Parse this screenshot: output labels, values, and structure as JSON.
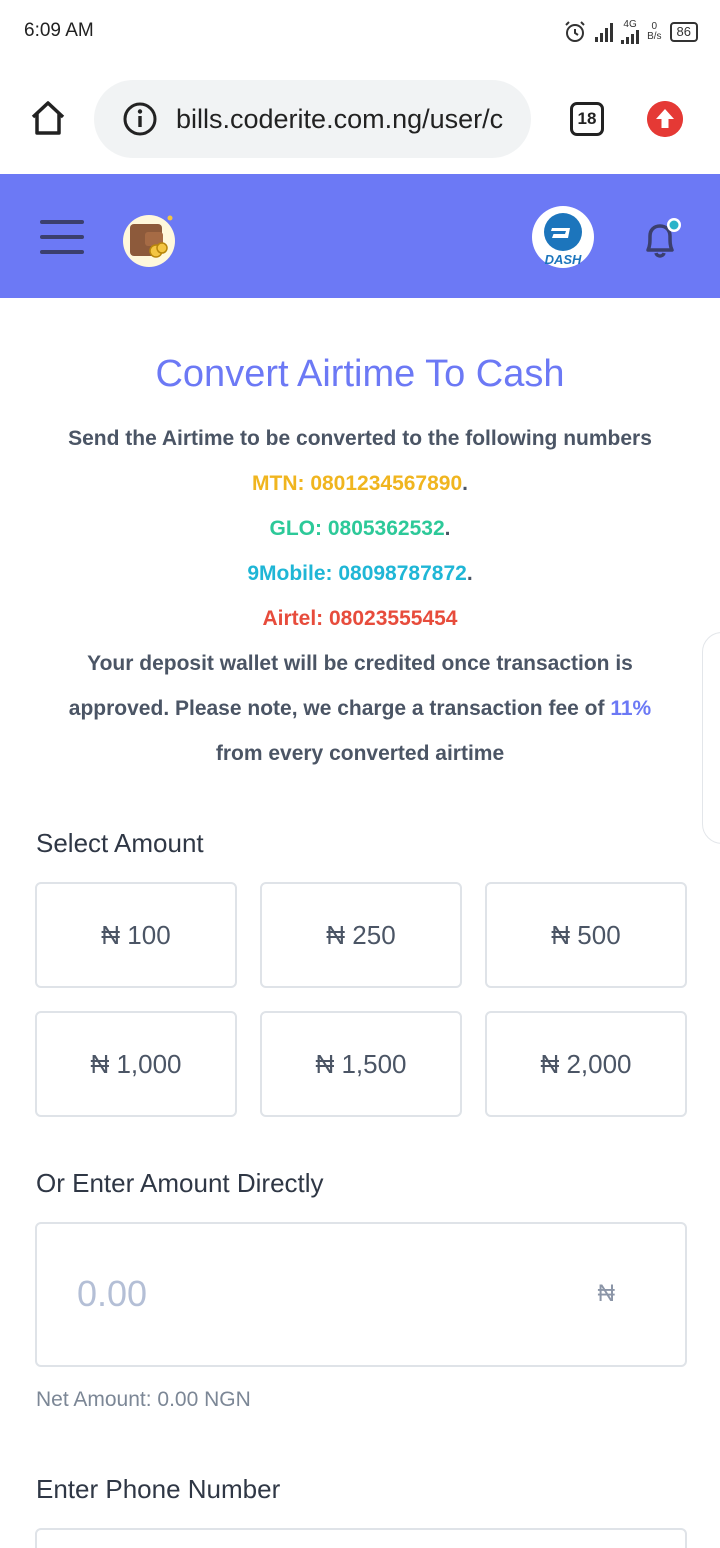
{
  "status_bar": {
    "time": "6:09 AM",
    "network": "4G",
    "speed_value": "0",
    "speed_unit": "B/s",
    "battery": "86"
  },
  "browser": {
    "url": "bills.coderite.com.ng/user/c",
    "tab_count": "18"
  },
  "header": {
    "dash_label": "DASH"
  },
  "main": {
    "title": "Convert Airtime To Cash",
    "intro": "Send the Airtime to be converted to the following numbers",
    "numbers": [
      {
        "label": "MTN: 0801234567890",
        "suffix": "."
      },
      {
        "label": "GLO: 0805362532",
        "suffix": "."
      },
      {
        "label": "9Mobile: 08098787872",
        "suffix": "."
      },
      {
        "label": "Airtel: 08023555454",
        "suffix": ""
      }
    ],
    "note_1": "Your deposit wallet will be credited once transaction is",
    "note_2": "approved. Please note, we charge a transaction fee of",
    "fee": "11%",
    "note_3": "from every converted airtime",
    "select_amount_label": "Select Amount",
    "amounts": [
      "₦ 100",
      "₦ 250",
      "₦ 500",
      "₦ 1,000",
      "₦ 1,500",
      "₦ 2,000"
    ],
    "enter_amount_label": "Or Enter Amount Directly",
    "amount_placeholder": "0.00",
    "currency_symbol": "₦",
    "net_amount": "Net Amount: 0.00 NGN",
    "phone_label": "Enter Phone Number"
  },
  "colors": {
    "accent": "#6c79f5",
    "mtn": "#f0b51f",
    "glo": "#2dc999",
    "9mobile": "#1fb6d6",
    "airtel": "#e74c3c"
  }
}
